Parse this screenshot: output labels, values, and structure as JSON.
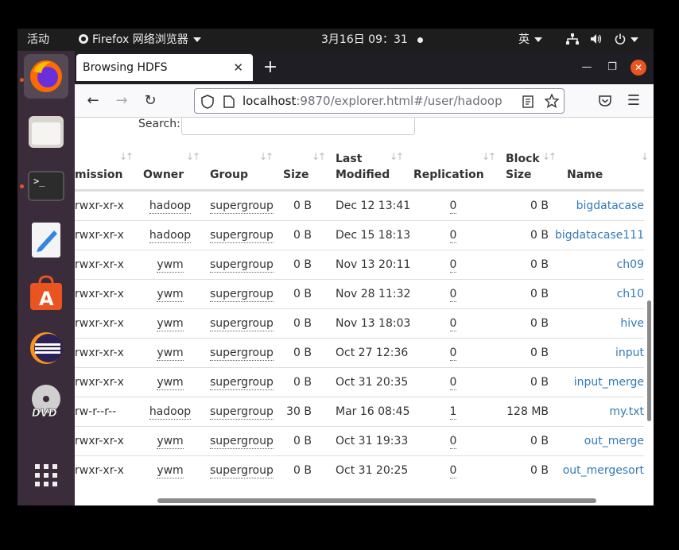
{
  "topbar": {
    "activities": "活动",
    "app_name": "Firefox 网络浏览器",
    "clock": "3月16日  09：31",
    "input_method": "英"
  },
  "dock": {
    "items": [
      "firefox",
      "files",
      "terminal",
      "text-editor",
      "software-center",
      "eclipse",
      "dvd",
      "app-grid"
    ]
  },
  "browser": {
    "tab_title": "Browsing HDFS",
    "url_host": "localhost",
    "url_rest": ":9870/explorer.html#/user/hadoop"
  },
  "page": {
    "search_label": "Search:",
    "search_value": ""
  },
  "table": {
    "headers": {
      "permission": "mission",
      "owner": "Owner",
      "group": "Group",
      "size": "Size",
      "last_modified_1": "Last",
      "last_modified_2": "Modified",
      "replication": "Replication",
      "block_size_1": "Block",
      "block_size_2": "Size",
      "name": "Name"
    },
    "rows": [
      {
        "perm": "rwxr-xr-x",
        "owner": "hadoop",
        "group": "supergroup",
        "size": "0 B",
        "modified": "Dec 12 13:41",
        "repl": "0",
        "block": "0 B",
        "name": "bigdatacase"
      },
      {
        "perm": "rwxr-xr-x",
        "owner": "hadoop",
        "group": "supergroup",
        "size": "0 B",
        "modified": "Dec 15 18:13",
        "repl": "0",
        "block": "0 B",
        "name": "bigdatacase111"
      },
      {
        "perm": "rwxr-xr-x",
        "owner": "ywm",
        "group": "supergroup",
        "size": "0 B",
        "modified": "Nov 13 20:11",
        "repl": "0",
        "block": "0 B",
        "name": "ch09"
      },
      {
        "perm": "rwxr-xr-x",
        "owner": "ywm",
        "group": "supergroup",
        "size": "0 B",
        "modified": "Nov 28 11:32",
        "repl": "0",
        "block": "0 B",
        "name": "ch10"
      },
      {
        "perm": "rwxr-xr-x",
        "owner": "ywm",
        "group": "supergroup",
        "size": "0 B",
        "modified": "Nov 13 18:03",
        "repl": "0",
        "block": "0 B",
        "name": "hive"
      },
      {
        "perm": "rwxr-xr-x",
        "owner": "ywm",
        "group": "supergroup",
        "size": "0 B",
        "modified": "Oct 27 12:36",
        "repl": "0",
        "block": "0 B",
        "name": "input"
      },
      {
        "perm": "rwxr-xr-x",
        "owner": "ywm",
        "group": "supergroup",
        "size": "0 B",
        "modified": "Oct 31 20:35",
        "repl": "0",
        "block": "0 B",
        "name": "input_merge"
      },
      {
        "perm": "rw-r--r--",
        "owner": "hadoop",
        "group": "supergroup",
        "size": "30 B",
        "modified": "Mar 16 08:45",
        "repl": "1",
        "block": "128 MB",
        "name": "my.txt"
      },
      {
        "perm": "rwxr-xr-x",
        "owner": "ywm",
        "group": "supergroup",
        "size": "0 B",
        "modified": "Oct 31 19:33",
        "repl": "0",
        "block": "0 B",
        "name": "out_merge"
      },
      {
        "perm": "rwxr-xr-x",
        "owner": "ywm",
        "group": "supergroup",
        "size": "0 B",
        "modified": "Oct 31 20:25",
        "repl": "0",
        "block": "0 B",
        "name": "out_mergesort"
      }
    ]
  },
  "colors": {
    "link": "#337ab7",
    "close_button": "#e95420",
    "dock_bg": "#3b2c3b"
  }
}
